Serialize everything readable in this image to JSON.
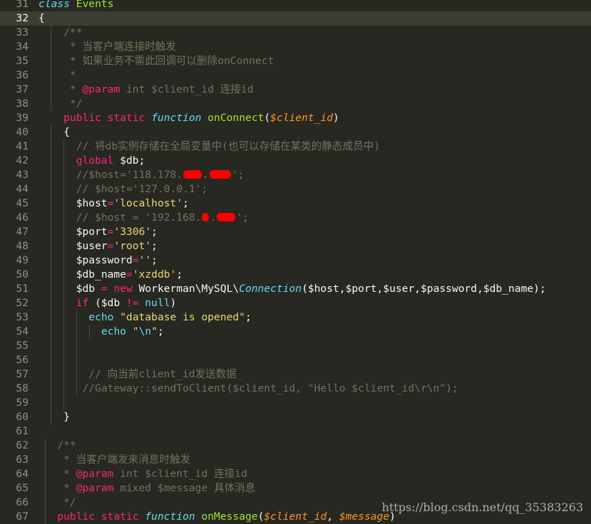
{
  "editor": {
    "current_line": "32",
    "colors": {
      "background": "#272822",
      "keyword": "#f92672",
      "storage": "#66d9ef",
      "function_name": "#a6e22e",
      "parameter": "#fd971f",
      "string": "#e6db74",
      "comment": "#75715e",
      "redaction": "#ff0000"
    },
    "lines": [
      {
        "num": "31",
        "tokens": [
          {
            "t": "class",
            "c": "storage"
          },
          {
            "t": " "
          },
          {
            "t": "Events",
            "c": "class"
          }
        ]
      },
      {
        "num": "32",
        "tokens": [
          {
            "t": "{"
          }
        ]
      },
      {
        "num": "33",
        "tokens": [
          {
            "t": "    /**",
            "c": "comment"
          }
        ]
      },
      {
        "num": "34",
        "tokens": [
          {
            "t": "     * 当客户端连接时触发",
            "c": "comment"
          }
        ]
      },
      {
        "num": "35",
        "tokens": [
          {
            "t": "     * 如果业务不需此回调可以删除onConnect",
            "c": "comment"
          }
        ]
      },
      {
        "num": "36",
        "tokens": [
          {
            "t": "     *",
            "c": "comment"
          }
        ]
      },
      {
        "num": "37",
        "tokens": [
          {
            "t": "     * ",
            "c": "comment"
          },
          {
            "t": "@param",
            "c": "kw"
          },
          {
            "t": " int $client_id 连接id",
            "c": "comment"
          }
        ]
      },
      {
        "num": "38",
        "tokens": [
          {
            "t": "     */",
            "c": "comment"
          }
        ]
      },
      {
        "num": "39",
        "tokens": [
          {
            "t": "    "
          },
          {
            "t": "public",
            "c": "kw"
          },
          {
            "t": " "
          },
          {
            "t": "static",
            "c": "kw"
          },
          {
            "t": " "
          },
          {
            "t": "function",
            "c": "storage"
          },
          {
            "t": " "
          },
          {
            "t": "onConnect",
            "c": "fn"
          },
          {
            "t": "("
          },
          {
            "t": "$client_id",
            "c": "param"
          },
          {
            "t": ")"
          }
        ]
      },
      {
        "num": "40",
        "tokens": [
          {
            "t": "    {"
          }
        ]
      },
      {
        "num": "41",
        "tokens": [
          {
            "t": "      // 将db实例存储在全局变量中(也可以存储在某类的静态成员中)",
            "c": "comment"
          }
        ]
      },
      {
        "num": "42",
        "tokens": [
          {
            "t": "      "
          },
          {
            "t": "global",
            "c": "kw"
          },
          {
            "t": " $db;"
          }
        ]
      },
      {
        "num": "43",
        "tokens": [
          {
            "t": "      //$host='118.178.",
            "c": "comment"
          },
          {
            "redact": 26
          },
          {
            "t": ".",
            "c": "comment"
          },
          {
            "redact": 30
          },
          {
            "t": "';",
            "c": "comment"
          }
        ]
      },
      {
        "num": "44",
        "tokens": [
          {
            "t": "      // $host='127.0.0.1';",
            "c": "comment"
          }
        ]
      },
      {
        "num": "45",
        "tokens": [
          {
            "t": "      $host"
          },
          {
            "t": "=",
            "c": "kw"
          },
          {
            "t": "'localhost'",
            "c": "str"
          },
          {
            "t": ";"
          }
        ]
      },
      {
        "num": "46",
        "tokens": [
          {
            "t": "      // $host = '192.168.",
            "c": "comment"
          },
          {
            "redact": 10
          },
          {
            "t": ".",
            "c": "comment"
          },
          {
            "redact": 26
          },
          {
            "t": "';",
            "c": "comment"
          }
        ]
      },
      {
        "num": "47",
        "tokens": [
          {
            "t": "      $port"
          },
          {
            "t": "=",
            "c": "kw"
          },
          {
            "t": "'3306'",
            "c": "str"
          },
          {
            "t": ";"
          }
        ]
      },
      {
        "num": "48",
        "tokens": [
          {
            "t": "      $user"
          },
          {
            "t": "=",
            "c": "kw"
          },
          {
            "t": "'root'",
            "c": "str"
          },
          {
            "t": ";"
          }
        ]
      },
      {
        "num": "49",
        "tokens": [
          {
            "t": "      $password"
          },
          {
            "t": "=",
            "c": "kw"
          },
          {
            "t": "''",
            "c": "str"
          },
          {
            "t": ";"
          }
        ]
      },
      {
        "num": "50",
        "tokens": [
          {
            "t": "      $db_name"
          },
          {
            "t": "=",
            "c": "kw"
          },
          {
            "t": "'xzddb'",
            "c": "str"
          },
          {
            "t": ";"
          }
        ]
      },
      {
        "num": "51",
        "tokens": [
          {
            "t": "      $db "
          },
          {
            "t": "=",
            "c": "kw"
          },
          {
            "t": " "
          },
          {
            "t": "new",
            "c": "kw"
          },
          {
            "t": " Workerman\\MySQL\\"
          },
          {
            "t": "Connection",
            "c": "clsital"
          },
          {
            "t": "($host,$port,$user,$password,$db_name);"
          }
        ]
      },
      {
        "num": "52",
        "tokens": [
          {
            "t": "      "
          },
          {
            "t": "if",
            "c": "kw"
          },
          {
            "t": " ($db "
          },
          {
            "t": "!=",
            "c": "kw"
          },
          {
            "t": " "
          },
          {
            "t": "null",
            "c": "const"
          },
          {
            "t": ")"
          }
        ]
      },
      {
        "num": "53",
        "tokens": [
          {
            "t": "        "
          },
          {
            "t": "echo",
            "c": "const"
          },
          {
            "t": " "
          },
          {
            "t": "\"database is opened\"",
            "c": "str"
          },
          {
            "t": ";"
          }
        ]
      },
      {
        "num": "54",
        "tokens": [
          {
            "t": "          "
          },
          {
            "t": "echo",
            "c": "const"
          },
          {
            "t": " "
          },
          {
            "t": "\"",
            "c": "str"
          },
          {
            "t": "\\n",
            "c": "const"
          },
          {
            "t": "\"",
            "c": "str"
          },
          {
            "t": ";"
          }
        ]
      },
      {
        "num": "55",
        "tokens": []
      },
      {
        "num": "56",
        "tokens": []
      },
      {
        "num": "57",
        "tokens": [
          {
            "t": "        // 向当前client_id发送数据",
            "c": "comment"
          }
        ]
      },
      {
        "num": "58",
        "tokens": [
          {
            "t": "       //Gateway::sendToClient($client_id, \"Hello $client_id\\r\\n\");",
            "c": "comment"
          }
        ]
      },
      {
        "num": "59",
        "tokens": []
      },
      {
        "num": "60",
        "tokens": [
          {
            "t": "    }"
          }
        ]
      },
      {
        "num": "61",
        "tokens": []
      },
      {
        "num": "62",
        "tokens": [
          {
            "t": "   /**",
            "c": "comment"
          }
        ]
      },
      {
        "num": "63",
        "tokens": [
          {
            "t": "    * 当客户端发来消息时触发",
            "c": "comment"
          }
        ]
      },
      {
        "num": "64",
        "tokens": [
          {
            "t": "    * ",
            "c": "comment"
          },
          {
            "t": "@param",
            "c": "kw"
          },
          {
            "t": " int $client_id 连接id",
            "c": "comment"
          }
        ]
      },
      {
        "num": "65",
        "tokens": [
          {
            "t": "    * ",
            "c": "comment"
          },
          {
            "t": "@param",
            "c": "kw"
          },
          {
            "t": " mixed $message 具体消息",
            "c": "comment"
          }
        ]
      },
      {
        "num": "66",
        "tokens": [
          {
            "t": "    */",
            "c": "comment"
          }
        ]
      },
      {
        "num": "67",
        "tokens": [
          {
            "t": "   "
          },
          {
            "t": "public",
            "c": "kw"
          },
          {
            "t": " "
          },
          {
            "t": "static",
            "c": "kw"
          },
          {
            "t": " "
          },
          {
            "t": "function",
            "c": "storage"
          },
          {
            "t": " "
          },
          {
            "t": "onMessage",
            "c": "fn"
          },
          {
            "t": "("
          },
          {
            "t": "$client_id",
            "c": "param"
          },
          {
            "t": ", "
          },
          {
            "t": "$message",
            "c": "param"
          },
          {
            "t": ")"
          }
        ]
      }
    ]
  },
  "watermark": "https://blog.csdn.net/qq_35383263"
}
